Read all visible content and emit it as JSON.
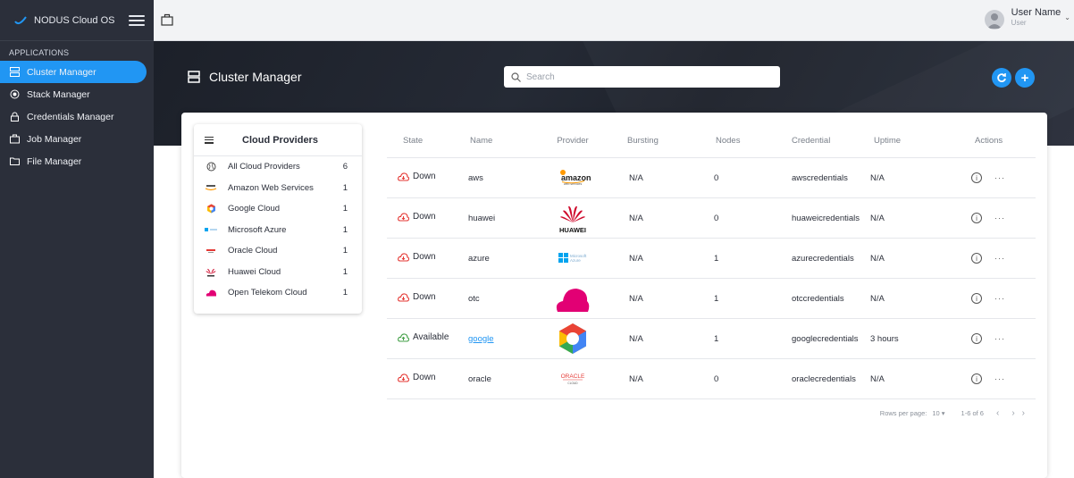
{
  "brand": {
    "name": "NODUS Cloud OS"
  },
  "sidebar": {
    "section_label": "APPLICATIONS",
    "items": [
      {
        "label": "Cluster Manager",
        "icon": "server-icon",
        "active": true
      },
      {
        "label": "Stack Manager",
        "icon": "target-icon",
        "active": false
      },
      {
        "label": "Credentials Manager",
        "icon": "lock-icon",
        "active": false
      },
      {
        "label": "Job Manager",
        "icon": "briefcase-icon",
        "active": false
      },
      {
        "label": "File Manager",
        "icon": "folder-icon",
        "active": false
      }
    ]
  },
  "user": {
    "name": "User Name",
    "role": "User"
  },
  "header": {
    "title": "Cluster Manager",
    "search_placeholder": "Search"
  },
  "providers": {
    "title": "Cloud Providers",
    "items": [
      {
        "label": "All Cloud Providers",
        "count": "6",
        "icon": "globe-icon"
      },
      {
        "label": "Amazon Web Services",
        "count": "1",
        "icon": "aws-logo-icon"
      },
      {
        "label": "Google Cloud",
        "count": "1",
        "icon": "google-cloud-icon"
      },
      {
        "label": "Microsoft Azure",
        "count": "1",
        "icon": "azure-logo-icon"
      },
      {
        "label": "Oracle Cloud",
        "count": "1",
        "icon": "oracle-logo-icon"
      },
      {
        "label": "Huawei Cloud",
        "count": "1",
        "icon": "huawei-logo-icon"
      },
      {
        "label": "Open Telekom Cloud",
        "count": "1",
        "icon": "otc-logo-icon"
      }
    ]
  },
  "table": {
    "headers": {
      "state": "State",
      "name": "Name",
      "provider": "Provider",
      "bursting": "Bursting",
      "nodes": "Nodes",
      "credential": "Credential",
      "uptime": "Uptime",
      "actions": "Actions"
    },
    "rows": [
      {
        "state": "Down",
        "name": "aws",
        "provider_logo": "amazon",
        "bursting": "N/A",
        "nodes": "0",
        "credential": "awscredentials",
        "uptime": "N/A"
      },
      {
        "state": "Down",
        "name": "huawei",
        "provider_logo": "huawei",
        "bursting": "N/A",
        "nodes": "0",
        "credential": "huaweicredentials",
        "uptime": "N/A"
      },
      {
        "state": "Down",
        "name": "azure",
        "provider_logo": "azure",
        "bursting": "N/A",
        "nodes": "1",
        "credential": "azurecredentials",
        "uptime": "N/A"
      },
      {
        "state": "Down",
        "name": "otc",
        "provider_logo": "otc",
        "bursting": "N/A",
        "nodes": "1",
        "credential": "otccredentials",
        "uptime": "N/A"
      },
      {
        "state": "Available",
        "name": "google",
        "provider_logo": "google",
        "bursting": "N/A",
        "nodes": "1",
        "credential": "googlecredentials",
        "uptime": "3 hours"
      },
      {
        "state": "Down",
        "name": "oracle",
        "provider_logo": "oracle",
        "bursting": "N/A",
        "nodes": "0",
        "credential": "oraclecredentials",
        "uptime": "N/A"
      }
    ]
  },
  "logos": {
    "amazon_text": "amazon",
    "amazon_sub": "web services",
    "huawei_text": "HUAWEI",
    "azure_text_1": "Microsoft",
    "azure_text_2": "Azure",
    "oracle_text": "ORACLE",
    "oracle_sub": "CLOUD"
  },
  "pager": {
    "rows_label": "Rows per page:",
    "rows_value": "10",
    "range": "1-6 of 6"
  },
  "colors": {
    "accent": "#2196f3",
    "down": "#e53935",
    "available": "#43a047",
    "sidebar": "#2b2f3a"
  }
}
